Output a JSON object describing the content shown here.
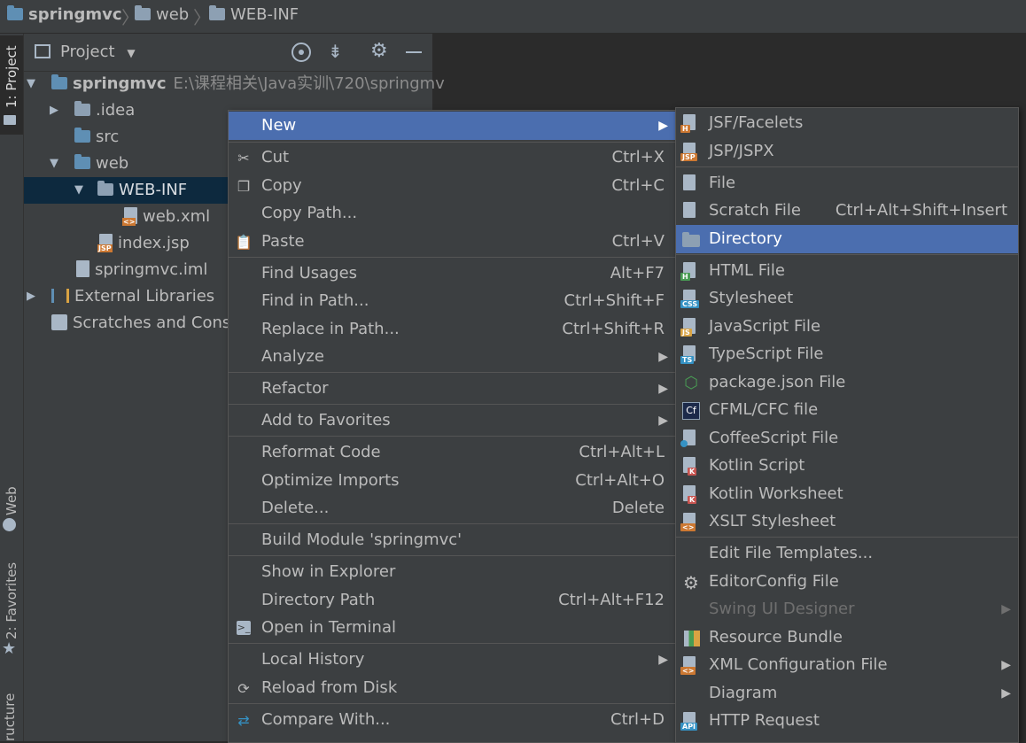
{
  "breadcrumb": {
    "project": "springmvc",
    "folder1": "web",
    "folder2": "WEB-INF"
  },
  "left_strip": {
    "project_tab": "1: Project",
    "web_tab": "Web",
    "favorites_tab": "2: Favorites",
    "structure_tab": "ructure"
  },
  "project_panel": {
    "title": "Project",
    "root": {
      "name": "springmvc",
      "path": "E:\\课程相关\\Java实训\\720\\springmv"
    },
    "items": [
      {
        "name": ".idea"
      },
      {
        "name": "src"
      },
      {
        "name": "web"
      },
      {
        "name": "WEB-INF"
      },
      {
        "name": "web.xml"
      },
      {
        "name": "index.jsp"
      },
      {
        "name": "springmvc.iml"
      },
      {
        "name": "External Libraries"
      },
      {
        "name": "Scratches and Consc"
      }
    ]
  },
  "context_menu": {
    "items": [
      {
        "label": "New",
        "shortcut": "",
        "submenu": true
      },
      {
        "label": "Cut",
        "shortcut": "Ctrl+X",
        "icon": "scissors-icon"
      },
      {
        "label": "Copy",
        "shortcut": "Ctrl+C",
        "icon": "copy-icon"
      },
      {
        "label": "Copy Path...",
        "shortcut": ""
      },
      {
        "label": "Paste",
        "shortcut": "Ctrl+V",
        "icon": "clipboard-icon"
      },
      {
        "label": "Find Usages",
        "shortcut": "Alt+F7"
      },
      {
        "label": "Find in Path...",
        "shortcut": "Ctrl+Shift+F"
      },
      {
        "label": "Replace in Path...",
        "shortcut": "Ctrl+Shift+R"
      },
      {
        "label": "Analyze",
        "shortcut": "",
        "submenu": true
      },
      {
        "label": "Refactor",
        "shortcut": "",
        "submenu": true
      },
      {
        "label": "Add to Favorites",
        "shortcut": "",
        "submenu": true
      },
      {
        "label": "Reformat Code",
        "shortcut": "Ctrl+Alt+L"
      },
      {
        "label": "Optimize Imports",
        "shortcut": "Ctrl+Alt+O"
      },
      {
        "label": "Delete...",
        "shortcut": "Delete"
      },
      {
        "label": "Build Module 'springmvc'",
        "shortcut": ""
      },
      {
        "label": "Show in Explorer",
        "shortcut": ""
      },
      {
        "label": "Directory Path",
        "shortcut": "Ctrl+Alt+F12"
      },
      {
        "label": "Open in Terminal",
        "shortcut": "",
        "icon": "terminal-icon"
      },
      {
        "label": "Local History",
        "shortcut": "",
        "submenu": true
      },
      {
        "label": "Reload from Disk",
        "shortcut": "",
        "icon": "reload-icon"
      },
      {
        "label": "Compare With...",
        "shortcut": "Ctrl+D",
        "icon": "compare-icon"
      }
    ]
  },
  "new_submenu": {
    "items": [
      {
        "label": "JSF/Facelets",
        "tag": "H",
        "tag_color": "#cc7832"
      },
      {
        "label": "JSP/JSPX",
        "tag": "JSP",
        "tag_color": "#cc7832"
      },
      {
        "label": "File",
        "shortcut": ""
      },
      {
        "label": "Scratch File",
        "shortcut": "Ctrl+Alt+Shift+Insert"
      },
      {
        "label": "Directory",
        "shortcut": ""
      },
      {
        "label": "HTML File",
        "tag": "H",
        "tag_color": "#499c54"
      },
      {
        "label": "Stylesheet",
        "tag": "CSS",
        "tag_color": "#3592c4"
      },
      {
        "label": "JavaScript File",
        "tag": "JS",
        "tag_color": "#d9a343"
      },
      {
        "label": "TypeScript File",
        "tag": "TS",
        "tag_color": "#3592c4"
      },
      {
        "label": "package.json File",
        "icon": "nodejs-icon"
      },
      {
        "label": "CFML/CFC file",
        "icon": "cf-icon"
      },
      {
        "label": "CoffeeScript File",
        "icon": "coffee-icon"
      },
      {
        "label": "Kotlin Script",
        "icon": "kotlin-icon"
      },
      {
        "label": "Kotlin Worksheet",
        "icon": "kotlin-icon"
      },
      {
        "label": "XSLT Stylesheet",
        "tag": "<>",
        "tag_color": "#cc7832"
      },
      {
        "label": "Edit File Templates...",
        "shortcut": ""
      },
      {
        "label": "EditorConfig File",
        "icon": "gear-icon"
      },
      {
        "label": "Swing UI Designer",
        "submenu": true,
        "disabled": true
      },
      {
        "label": "Resource Bundle",
        "icon": "bundle-icon"
      },
      {
        "label": "XML Configuration File",
        "submenu": true,
        "tag": "<>",
        "tag_color": "#cc7832"
      },
      {
        "label": "Diagram",
        "submenu": true
      },
      {
        "label": "HTTP Request",
        "tag": "API",
        "tag_color": "#3592c4"
      }
    ]
  },
  "colors": {
    "highlight": "#4b6eaf",
    "panel": "#3c3f41",
    "editor": "#2b2b2b",
    "selection": "#0d293e"
  }
}
